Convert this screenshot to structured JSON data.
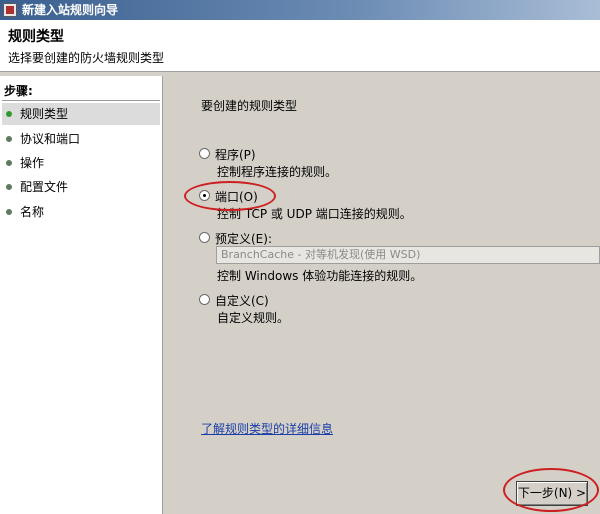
{
  "window": {
    "title": "新建入站规则向导"
  },
  "header": {
    "title": "规则类型",
    "subtitle": "选择要创建的防火墙规则类型"
  },
  "sidebar": {
    "steps_title": "步骤:",
    "items": [
      {
        "label": "规则类型",
        "current": true
      },
      {
        "label": "协议和端口",
        "current": false
      },
      {
        "label": "操作",
        "current": false
      },
      {
        "label": "配置文件",
        "current": false
      },
      {
        "label": "名称",
        "current": false
      }
    ]
  },
  "main": {
    "prompt": "要创建的规则类型",
    "options": [
      {
        "label": "程序(P)",
        "description": "控制程序连接的规则。",
        "selected": false
      },
      {
        "label": "端口(O)",
        "description": "控制 TCP 或 UDP 端口连接的规则。",
        "selected": true
      },
      {
        "label": "预定义(E):",
        "description": "控制 Windows 体验功能连接的规则。",
        "selected": false,
        "select_value": "BranchCache - 对等机发现(使用 WSD)"
      },
      {
        "label": "自定义(C)",
        "description": "自定义规则。",
        "selected": false
      }
    ],
    "learn_more_link": "了解规则类型的详细信息"
  },
  "footer": {
    "next_button": "下一步(N) >"
  },
  "colors": {
    "highlight_annotation": "#cc2020",
    "link": "#1a3ea8",
    "panel": "#d4d0c8"
  }
}
